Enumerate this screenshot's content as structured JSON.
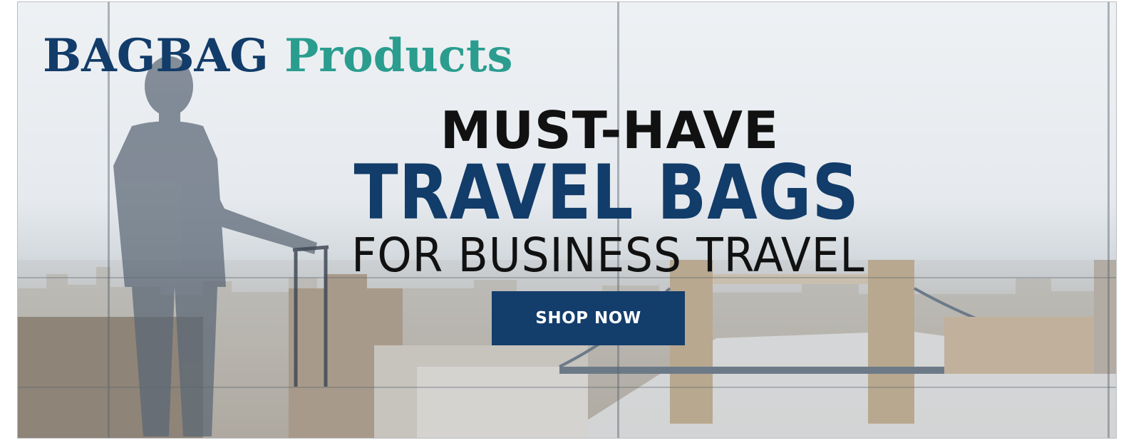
{
  "brand": {
    "name": "BAGBAG",
    "section": "Products",
    "colors": {
      "name": "#123c69",
      "section": "#2a9d8f"
    }
  },
  "hero": {
    "line1": "MUST-HAVE",
    "line2": "TRAVEL BAGS",
    "line3": "FOR BUSINESS TRAVEL",
    "cta_label": "SHOP NOW",
    "colors": {
      "accent": "#123c69",
      "text": "#111111",
      "button_text": "#ffffff"
    }
  },
  "background": {
    "scene_icon": "business-traveler-silhouette",
    "landmark_icon": "tower-bridge-cityscape"
  }
}
